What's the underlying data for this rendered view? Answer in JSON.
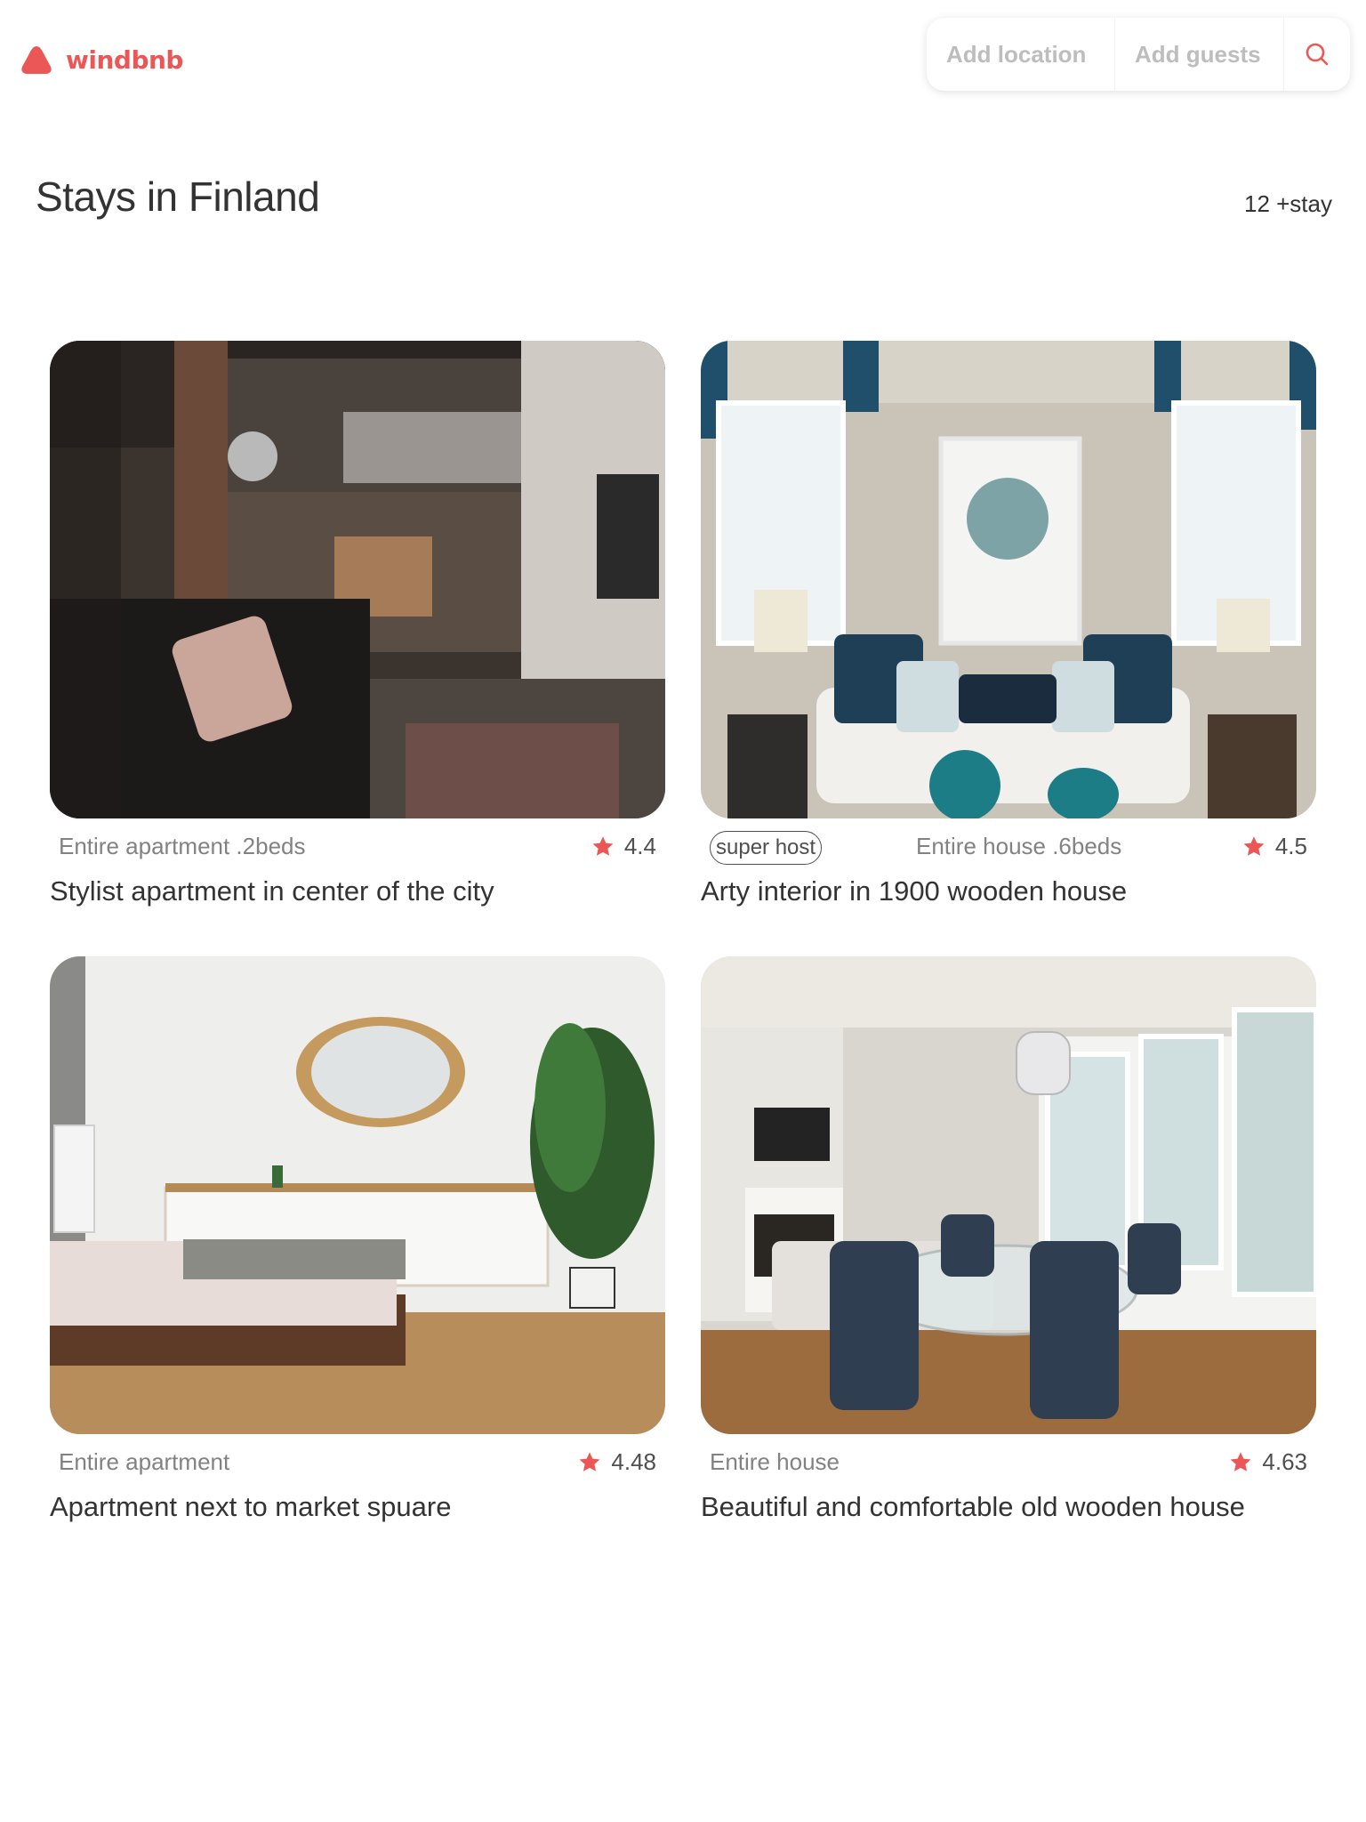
{
  "brand": {
    "name": "windbnb",
    "color": "#eb5757"
  },
  "search": {
    "location_placeholder": "Add location",
    "guests_placeholder": "Add guests",
    "button_icon": "search-icon"
  },
  "page": {
    "title": "Stays in Finland",
    "count": "12 +stay"
  },
  "stays": [
    {
      "type": "Entire apartment .2beds",
      "rating": "4.4",
      "title": "Stylist apartment in center of the city",
      "superhost": ""
    },
    {
      "type": "Entire house .6beds",
      "rating": "4.5",
      "title": "Arty interior in 1900 wooden house",
      "superhost": "super host"
    },
    {
      "type": "Entire apartment",
      "rating": "4.48",
      "title": "Apartment next to market spuare",
      "superhost": ""
    },
    {
      "type": "Entire house",
      "rating": "4.63",
      "title": "Beautiful and comfortable old wooden house",
      "superhost": ""
    }
  ],
  "colors": {
    "star": "#eb5757",
    "text": "#333333",
    "muted": "#828282"
  }
}
